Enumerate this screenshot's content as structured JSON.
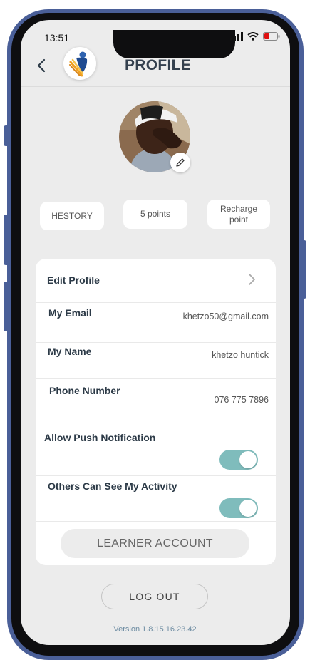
{
  "status_bar": {
    "time": "13:51"
  },
  "header": {
    "title": "PROFILE"
  },
  "chips": [
    {
      "label": "HESTORY"
    },
    {
      "label": "5 points"
    },
    {
      "label": "Recharge point"
    }
  ],
  "settings": {
    "edit_profile": "Edit Profile",
    "email": {
      "label": "My Email",
      "value": "khetzo50@gmail.com"
    },
    "name": {
      "label": "My Name",
      "value": "khetzo huntick"
    },
    "phone": {
      "label": "Phone Number",
      "value": "076 775 7896"
    },
    "push_notification": {
      "label": "Allow Push Notification",
      "enabled": true
    },
    "activity_visibility": {
      "label": "Others Can See My Activity",
      "enabled": true
    },
    "learner_account": "LEARNER ACCOUNT"
  },
  "logout_label": "LOG OUT",
  "version": "Version 1.8.15.16.23.42",
  "colors": {
    "frame": "#4a5f98",
    "toggle_on": "#7fbcbc",
    "title": "#34404e"
  }
}
